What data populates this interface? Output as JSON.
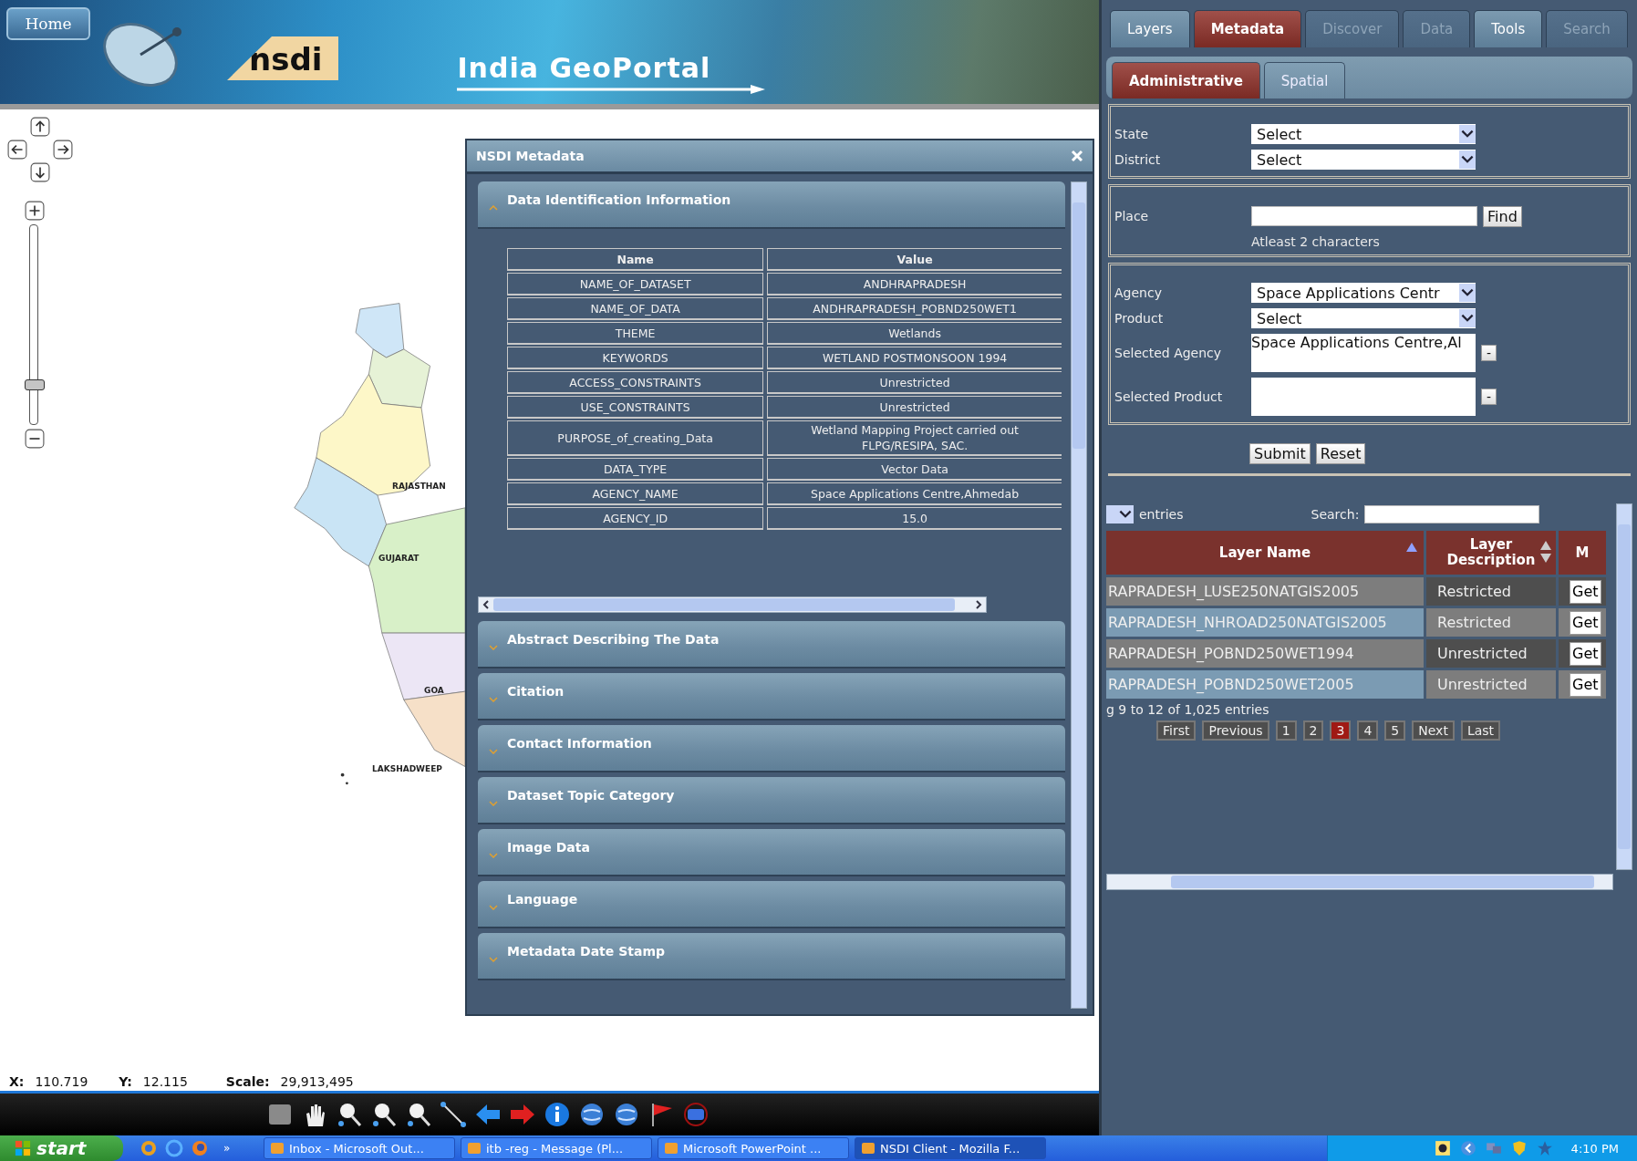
{
  "header": {
    "home_button": "Home",
    "logo_text": "nsdi",
    "title": "India GeoPortal"
  },
  "map": {
    "zoom_slider": {
      "level": 0.2
    },
    "labels": [
      "RAJASTHAN",
      "GUJARAT",
      "GOA",
      "LAKSHADWEEP"
    ]
  },
  "metadata_dialog": {
    "title": "NSDI Metadata",
    "sections": [
      {
        "title": "Data Identification Information",
        "expanded": true
      },
      {
        "title": "Abstract Describing The Data",
        "expanded": false
      },
      {
        "title": "Citation",
        "expanded": false
      },
      {
        "title": "Contact Information",
        "expanded": false
      },
      {
        "title": "Dataset Topic Category",
        "expanded": false
      },
      {
        "title": "Image Data",
        "expanded": false
      },
      {
        "title": "Language",
        "expanded": false
      },
      {
        "title": "Metadata Date Stamp",
        "expanded": false
      }
    ],
    "table": {
      "columns": [
        "Name",
        "Value"
      ],
      "rows": [
        [
          "NAME_OF_DATASET",
          "ANDHRAPRADESH"
        ],
        [
          "NAME_OF_DATA",
          "ANDHRAPRADESH_POBND250WET1"
        ],
        [
          "THEME",
          "Wetlands"
        ],
        [
          "KEYWORDS",
          "WETLAND POSTMONSOON 1994"
        ],
        [
          "ACCESS_CONSTRAINTS",
          "Unrestricted"
        ],
        [
          "USE_CONSTRAINTS",
          "Unrestricted"
        ],
        [
          "PURPOSE_of_creating_Data",
          "Wetland Mapping Project carried out\nFLPG/RESIPA, SAC."
        ],
        [
          "DATA_TYPE",
          "Vector Data"
        ],
        [
          "AGENCY_NAME",
          "Space Applications Centre,Ahmedab"
        ],
        [
          "AGENCY_ID",
          "15.0"
        ]
      ]
    }
  },
  "status": {
    "x_label": "X:",
    "x_value": "110.719",
    "y_label": "Y:",
    "y_value": "12.115",
    "scale_label": "Scale:",
    "scale_value": "29,913,495"
  },
  "side_panel": {
    "tabs": [
      {
        "label": "Layers",
        "selected": false,
        "disabled": false
      },
      {
        "label": "Metadata",
        "selected": true,
        "disabled": false
      },
      {
        "label": "Discover",
        "selected": false,
        "disabled": true
      },
      {
        "label": "Data",
        "selected": false,
        "disabled": true
      },
      {
        "label": "Tools",
        "selected": false,
        "disabled": false
      },
      {
        "label": "Search",
        "selected": false,
        "disabled": true
      }
    ],
    "subtabs": [
      {
        "label": "Administrative",
        "selected": true
      },
      {
        "label": "Spatial",
        "selected": false
      }
    ],
    "state": {
      "label": "State",
      "value": "Select"
    },
    "district": {
      "label": "District",
      "value": "Select"
    },
    "place": {
      "label": "Place",
      "button": "Find",
      "hint": "Atleast 2 characters"
    },
    "agency": {
      "label": "Agency",
      "value": "Space Applications Centr"
    },
    "product": {
      "label": "Product",
      "value": "Select"
    },
    "selected_agency": {
      "label": "Selected Agency",
      "value": "Space Applications Centre,Al",
      "button": "-"
    },
    "selected_product": {
      "label": "Selected Product",
      "button": "-"
    },
    "submit": "Submit",
    "reset": "Reset",
    "layers_table": {
      "entries_label": "entries",
      "search_label": "Search:",
      "columns": [
        {
          "label": "Layer Name",
          "sorted": true
        },
        {
          "label": "Layer Description",
          "sorted": false
        },
        {
          "label": "M"
        }
      ],
      "rows": [
        {
          "name": "RAPRADESH_LUSE250NATGIS2005",
          "description": "Restricted",
          "action": "Get"
        },
        {
          "name": "RAPRADESH_NHROAD250NATGIS2005",
          "description": "Restricted",
          "action": "Get"
        },
        {
          "name": "RAPRADESH_POBND250WET1994",
          "description": "Unrestricted",
          "action": "Get"
        },
        {
          "name": "RAPRADESH_POBND250WET2005",
          "description": "Unrestricted",
          "action": "Get"
        }
      ],
      "info": "g 9 to 12 of 1,025 entries",
      "pager": {
        "first": "First",
        "previous": "Previous",
        "pages": [
          {
            "label": "1",
            "selected": false
          },
          {
            "label": "2",
            "selected": false
          },
          {
            "label": "3",
            "selected": true
          },
          {
            "label": "4",
            "selected": false
          },
          {
            "label": "5",
            "selected": false
          }
        ],
        "next": "Next",
        "last": "Last"
      }
    }
  },
  "taskbar": {
    "start": "start",
    "overflow": "»",
    "tasks": [
      {
        "label": "Inbox - Microsoft Out...",
        "selected": false
      },
      {
        "label": "itb -reg - Message (Pl...",
        "selected": false
      },
      {
        "label": "Microsoft PowerPoint ...",
        "selected": false
      },
      {
        "label": "NSDI Client - Mozilla F...",
        "selected": true
      }
    ],
    "clock": "4:10 PM"
  }
}
